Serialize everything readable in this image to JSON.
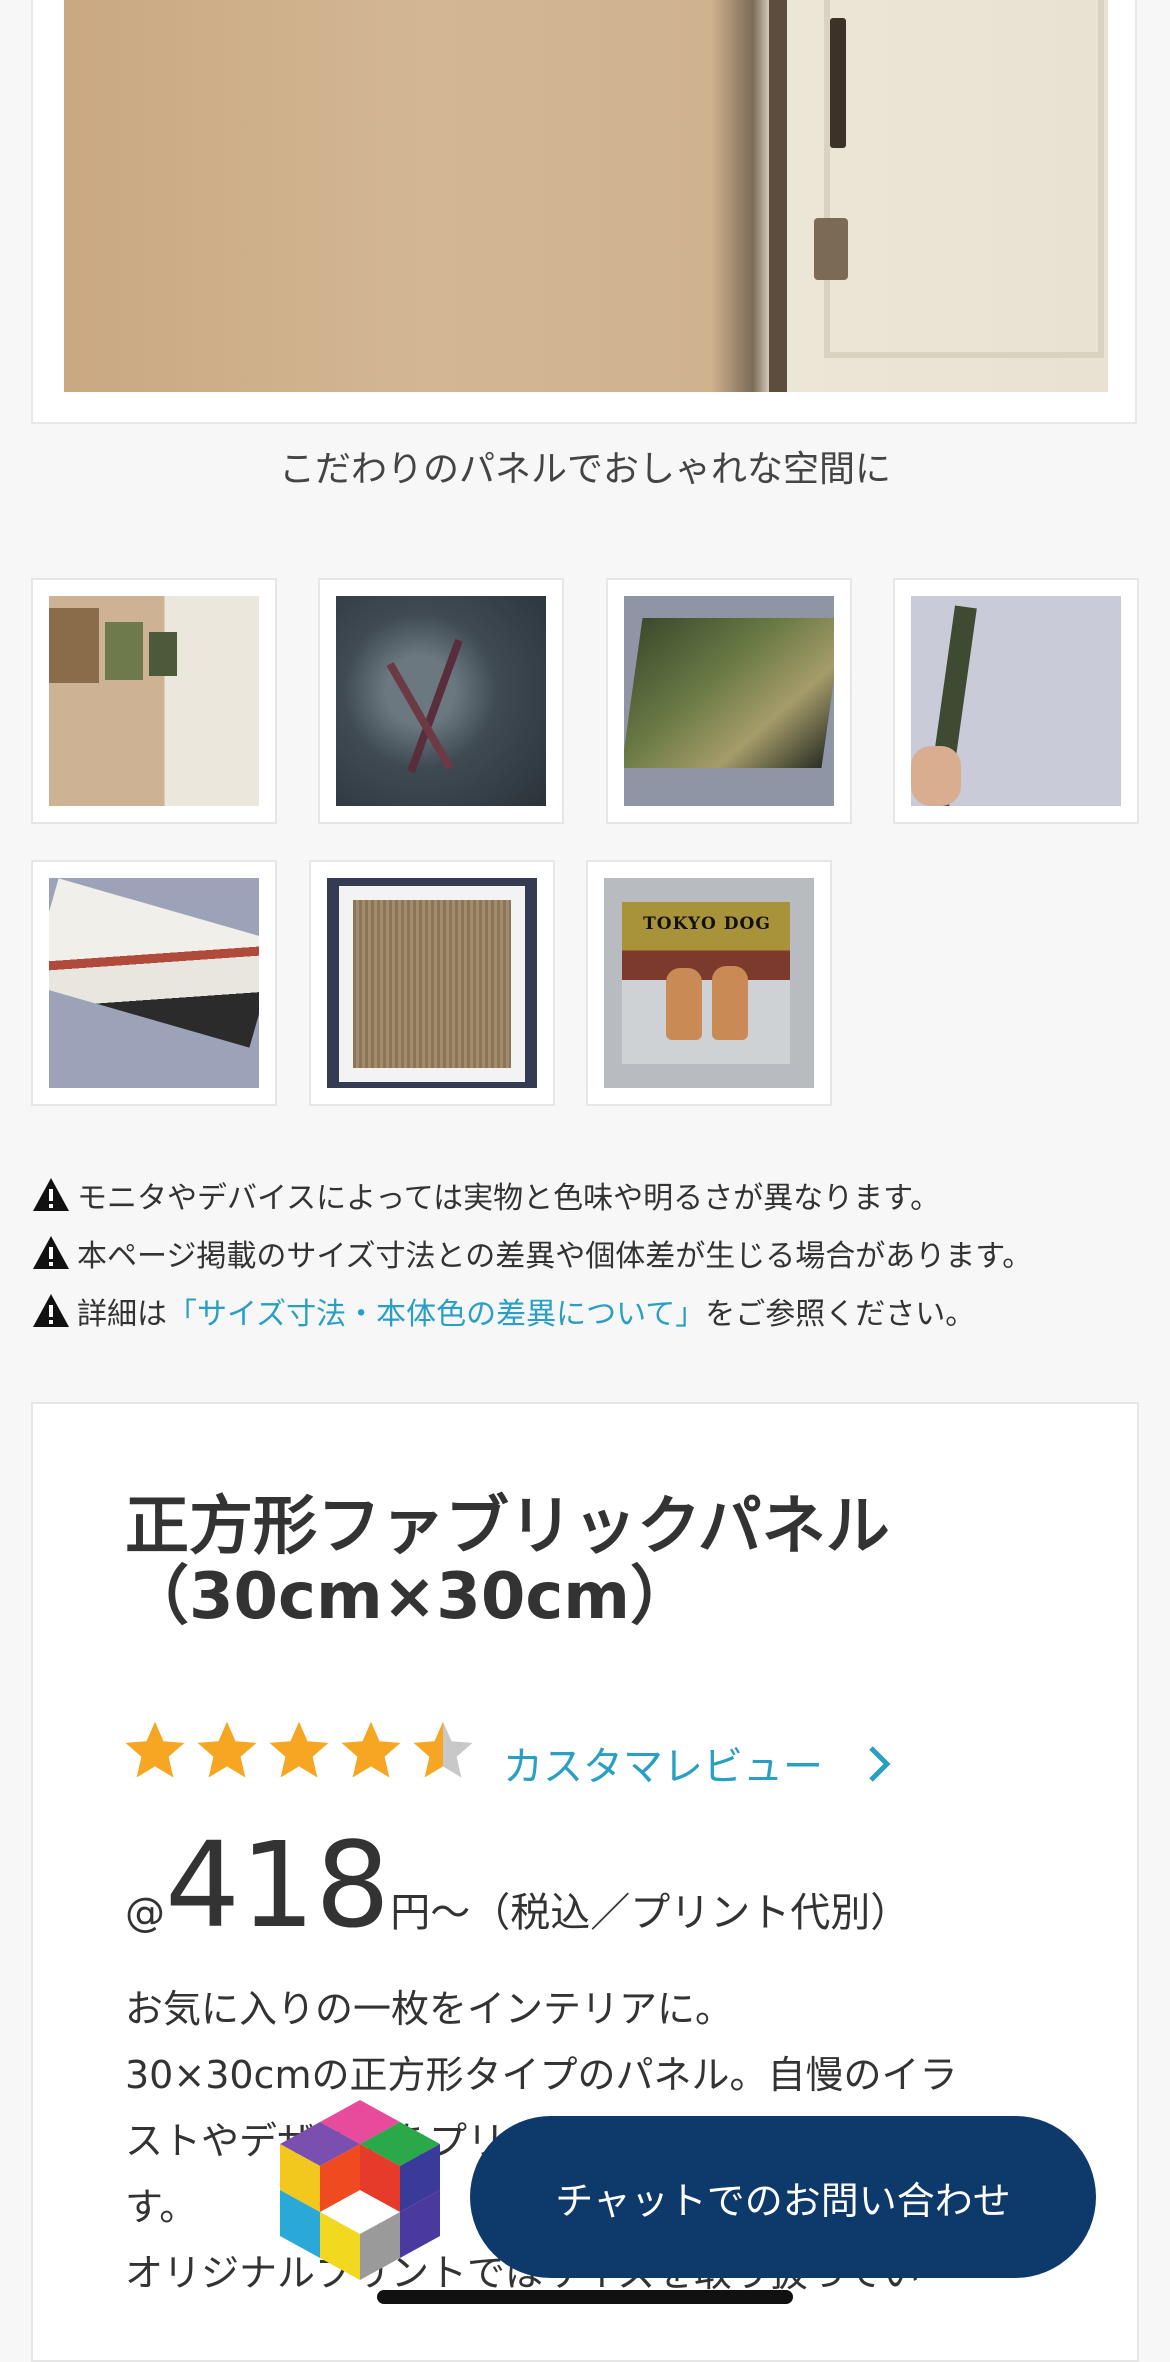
{
  "hero": {
    "caption": "こだわりのパネルでおしゃれな空間に"
  },
  "thumbnails": [
    {
      "name": "thumb-wall-gallery"
    },
    {
      "name": "thumb-plant-closeup"
    },
    {
      "name": "thumb-canvas-angle"
    },
    {
      "name": "thumb-hanging-panel"
    },
    {
      "name": "thumb-canvas-side"
    },
    {
      "name": "thumb-panel-back"
    },
    {
      "name": "thumb-tokyo-dog",
      "logo_text": "TOKYO DOG"
    }
  ],
  "notices": {
    "line1": "モニタやデバイスによっては実物と色味や明るさが異なります。",
    "line2": "本ページ掲載のサイズ寸法との差異や個体差が生じる場合があります。",
    "line3_prefix": "詳細は",
    "line3_link": "「サイズ寸法・本体色の差異について」",
    "line3_suffix": "をご参照ください。"
  },
  "product": {
    "title_line1": "正方形ファブリックパネル",
    "title_line2": "（30cm×30cm）",
    "rating": 4.5,
    "review_link": "カスタマレビュー",
    "price_prefix": "@",
    "price_amount": "418",
    "price_suffix": "円～（税込／プリント代別）",
    "desc_line1": "お気に入りの一枚をインテリアに。",
    "desc_line2": "30×30cmの正方形タイプのパネル。自慢のイラ",
    "desc_line3": "ストやデザインをプリ",
    "desc_line4": "す。",
    "desc_line5": "オリジナルプリントではサイズを取り扱ってい"
  },
  "chat": {
    "label": "チャットでのお問い合わせ"
  },
  "colors": {
    "accent_link": "#2a9fc4",
    "chat_button": "#0e3a6b",
    "star": "#f6a623"
  }
}
